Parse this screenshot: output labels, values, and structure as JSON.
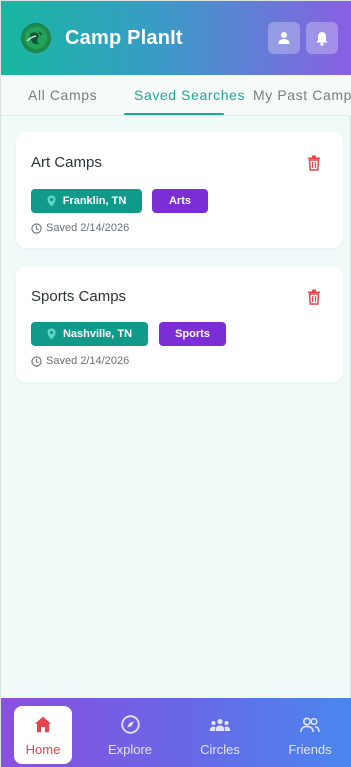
{
  "app": {
    "title": "Camp PlanIt"
  },
  "header": {
    "profile_icon": "person-icon",
    "notifications_icon": "bell-icon"
  },
  "tabs": [
    {
      "label": "All Camps",
      "active": false
    },
    {
      "label": "Saved Searches",
      "active": true
    },
    {
      "label": "My Past Camps",
      "active": false
    }
  ],
  "saved_searches": [
    {
      "title": "Art Camps",
      "location": "Franklin, TN",
      "category": "Arts",
      "saved": "Saved 2/14/2026"
    },
    {
      "title": "Sports Camps",
      "location": "Nashville, TN",
      "category": "Sports",
      "saved": "Saved 2/14/2026"
    }
  ],
  "nav": [
    {
      "label": "Home",
      "icon": "home-icon",
      "active": true
    },
    {
      "label": "Explore",
      "icon": "compass-icon",
      "active": false
    },
    {
      "label": "Circles",
      "icon": "group-icon",
      "active": false
    },
    {
      "label": "Friends",
      "icon": "friends-icon",
      "active": false
    }
  ],
  "colors": {
    "accent_teal": "#1aaa94",
    "location_chip": "#0f9a8a",
    "category_chip": "#7b2ed6",
    "delete_red": "#e4454a",
    "active_nav": "#e4454a"
  }
}
